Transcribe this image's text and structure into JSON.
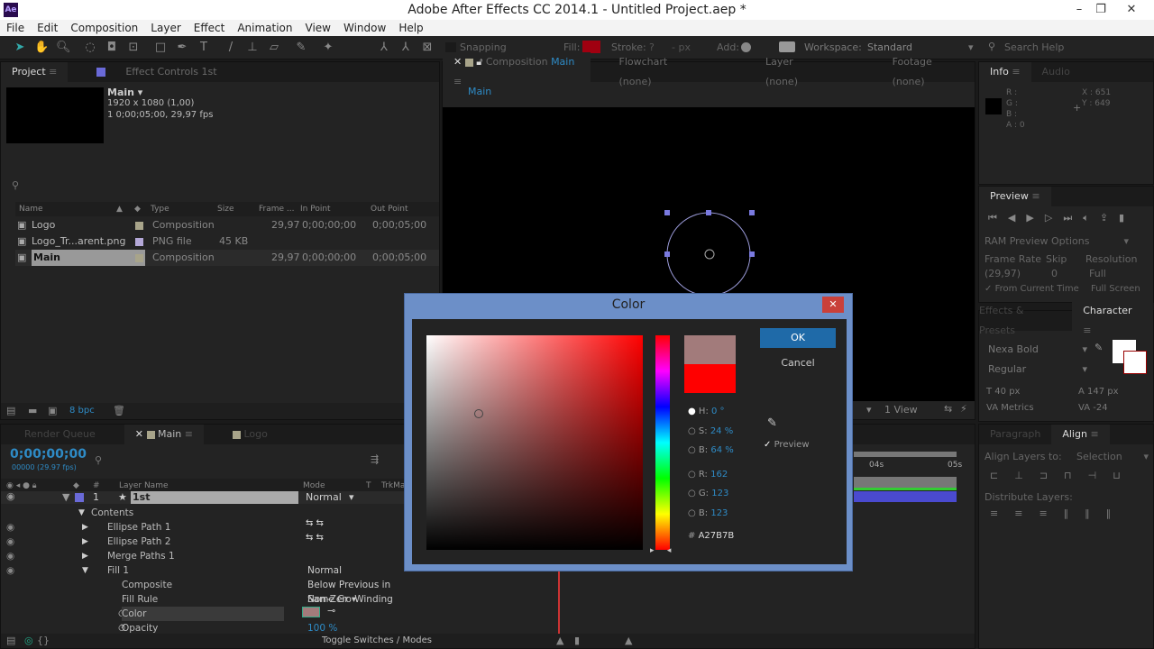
{
  "window": {
    "title": "Adobe After Effects CC 2014.1 - Untitled Project.aep *",
    "app_icon": "Ae",
    "minimize": "–",
    "maximize": "❐",
    "close": "✕"
  },
  "menu": [
    "File",
    "Edit",
    "Composition",
    "Layer",
    "Effect",
    "Animation",
    "View",
    "Window",
    "Help"
  ],
  "toolbar": {
    "snapping": "Snapping",
    "fill_label": "Fill:",
    "fill_color": "#a00010",
    "stroke_label": "Stroke:",
    "stroke_value": "?",
    "stroke_px": "- px",
    "add_label": "Add:",
    "workspace_label": "Workspace:",
    "workspace_value": "Standard",
    "search_placeholder": "Search Help"
  },
  "project": {
    "tab": "Project",
    "effect_controls": "Effect Controls",
    "effect_controls_layer": "1st",
    "selected_name": "Main ▾",
    "selected_res": "1920 x 1080 (1,00)",
    "selected_dur": "1 0;00;05;00, 29,97 fps",
    "columns": [
      "Name",
      "Type",
      "Size",
      "Frame ...",
      "In Point",
      "Out Point"
    ],
    "items": [
      {
        "name": "Logo",
        "type": "Composition",
        "size": "",
        "fps": "29,97",
        "in": "0;00;00;00",
        "out": "0;00;05;00",
        "label": "#a8a48a"
      },
      {
        "name": "Logo_Tr...arent.png",
        "type": "PNG file",
        "size": "45 KB",
        "fps": "",
        "in": "",
        "out": "",
        "label": "#b4a8d8"
      },
      {
        "name": "Main",
        "type": "Composition",
        "size": "",
        "fps": "29,97",
        "in": "0;00;00;00",
        "out": "0;00;05;00",
        "label": "#a8a48a"
      }
    ],
    "bpc": "8 bpc"
  },
  "composition": {
    "tab_prefix": "Composition",
    "tab_name": "Main",
    "flowchart": "Flowchart",
    "flowchart_val": "(none)",
    "layer": "Layer",
    "layer_val": "(none)",
    "footage": "Footage",
    "footage_val": "(none)",
    "breadcrumb": "Main",
    "view": "1 View"
  },
  "info": {
    "tab": "Info",
    "audio": "Audio",
    "r": "R :",
    "g": "G :",
    "b": "B :",
    "a": "A : 0",
    "x": "X : 651",
    "y": "Y : 649"
  },
  "preview": {
    "tab": "Preview",
    "ram": "RAM Preview Options",
    "frame_rate_label": "Frame Rate",
    "frame_rate": "(29,97)",
    "skip_label": "Skip",
    "skip": "0",
    "resolution_label": "Resolution",
    "resolution": "Full",
    "from_current": "From Current Time",
    "full_screen": "Full Screen"
  },
  "character": {
    "effects_tab": "Effects & Presets",
    "tab": "Character",
    "font": "Nexa Bold",
    "style": "Regular",
    "size": "40 px",
    "leading": "147 px",
    "kerning": "Metrics",
    "tracking": "-24"
  },
  "align": {
    "paragraph_tab": "Paragraph",
    "tab": "Align",
    "align_to_label": "Align Layers to:",
    "align_to": "Selection",
    "distribute": "Distribute Layers:"
  },
  "timeline": {
    "render_queue": "Render Queue",
    "tab_main": "Main",
    "tab_logo": "Logo",
    "timecode": "0;00;00;00",
    "frames": "00000 (29.97 fps)",
    "col_num": "#",
    "col_name": "Layer Name",
    "col_mode": "Mode",
    "col_t": "T",
    "col_trkmat": "TrkMat",
    "layer": {
      "num": "1",
      "name": "1st",
      "mode": "Normal"
    },
    "props": [
      {
        "name": "Contents",
        "indent": 1,
        "arrow": "▼",
        "value": ""
      },
      {
        "name": "Ellipse Path 1",
        "indent": 2,
        "arrow": "▶",
        "value": ""
      },
      {
        "name": "Ellipse Path 2",
        "indent": 2,
        "arrow": "▶",
        "value": ""
      },
      {
        "name": "Merge Paths 1",
        "indent": 2,
        "arrow": "▶",
        "value": ""
      },
      {
        "name": "Fill 1",
        "indent": 2,
        "arrow": "▼",
        "value": "Normal"
      },
      {
        "name": "Composite",
        "indent": 3,
        "arrow": "",
        "value": "Below Previous in Same Gr ▾"
      },
      {
        "name": "Fill Rule",
        "indent": 3,
        "arrow": "",
        "value": "Non-Zero Winding"
      },
      {
        "name": "Color",
        "indent": 3,
        "arrow": "",
        "value": ""
      },
      {
        "name": "Opacity",
        "indent": 3,
        "arrow": "",
        "value": "100 %"
      }
    ],
    "ruler": [
      "04s",
      "05s"
    ],
    "toggle": "Toggle Switches / Modes",
    "color_swatch": "#a27b7b"
  },
  "color_dialog": {
    "title": "Color",
    "ok": "OK",
    "cancel": "Cancel",
    "h_label": "H:",
    "h": "0 °",
    "s_label": "S:",
    "s": "24 %",
    "b_label": "B:",
    "b": "64 %",
    "r_label": "R:",
    "r": "162",
    "g_label": "G:",
    "g": "123",
    "bl_label": "B:",
    "bl": "123",
    "hex_label": "#",
    "hex": "A27B7B",
    "preview": "Preview",
    "new_color": "#a27b7b",
    "old_color": "#ff0000"
  }
}
